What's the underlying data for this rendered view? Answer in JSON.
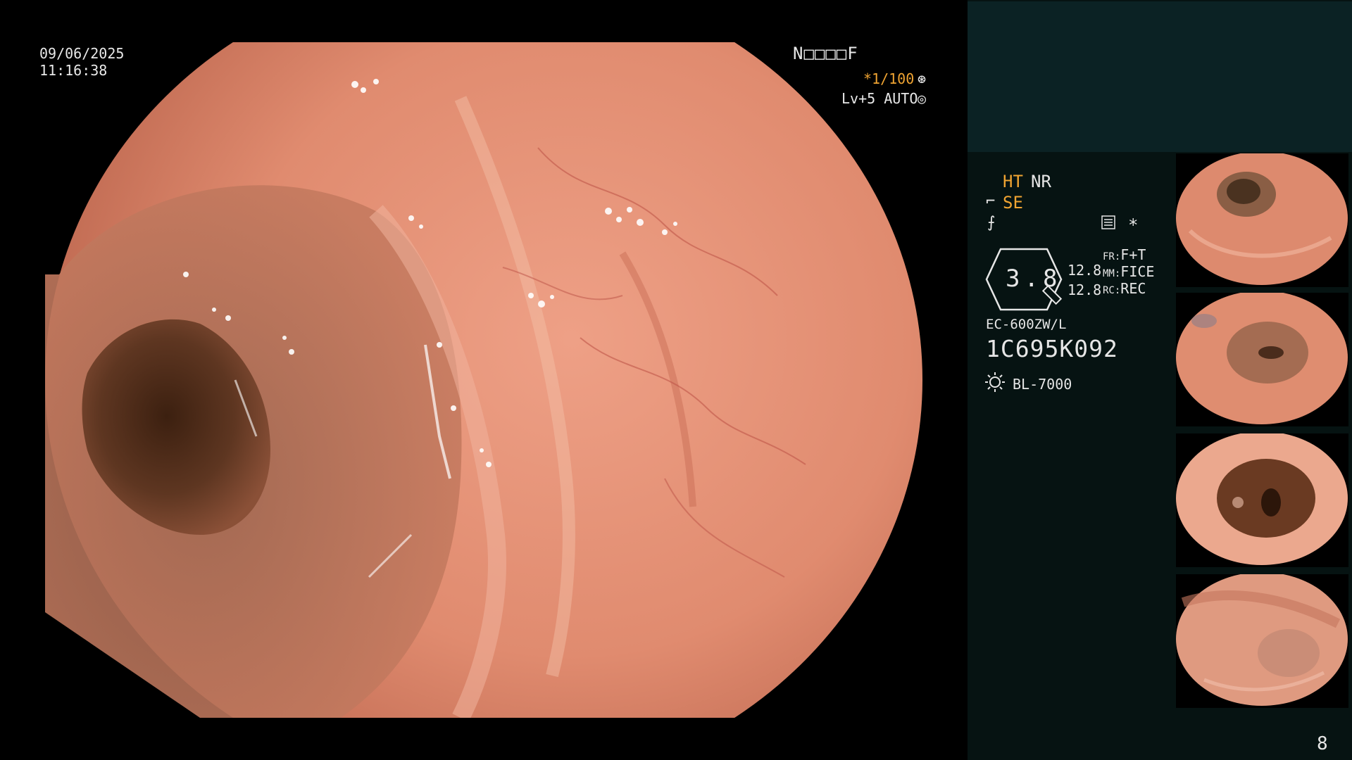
{
  "overlay": {
    "date": "09/06/2025",
    "time": "11:16:38",
    "record_code": "N□□□□F",
    "shutter": "*1/100",
    "shutter_icon": "⊛",
    "level": "Lv+5 AUTO",
    "level_icon": "◎"
  },
  "panel": {
    "ht": "HT",
    "nr": "NR",
    "se": "SE",
    "se_icon": "⌐",
    "freeze_icon": "⨍",
    "star": "*",
    "zoom": "3.8",
    "value_1": "12.8",
    "value_2": "12.8",
    "fr_label": "FR:",
    "fr_value": "F+T",
    "mm_label": "MM:",
    "mm_value": "FICE",
    "rc_label": "RC:",
    "rc_value": "REC",
    "scope_model": "EC-600ZW/L",
    "scope_serial": "1C695K092",
    "light_source": "BL-7000",
    "page_number": "8"
  },
  "icons": {
    "shutter": "aperture-icon",
    "level": "auto-iris-icon",
    "structure_enhance": "se-icon",
    "freeze": "freeze-icon",
    "menu": "menu-icon",
    "light": "light-source-icon"
  },
  "colors": {
    "accent_orange": "#f0a432",
    "panel_bg": "#061312",
    "panel_top_bg": "#0b2224",
    "mucosa": "#e38f74",
    "lumen": "#5a3420"
  }
}
